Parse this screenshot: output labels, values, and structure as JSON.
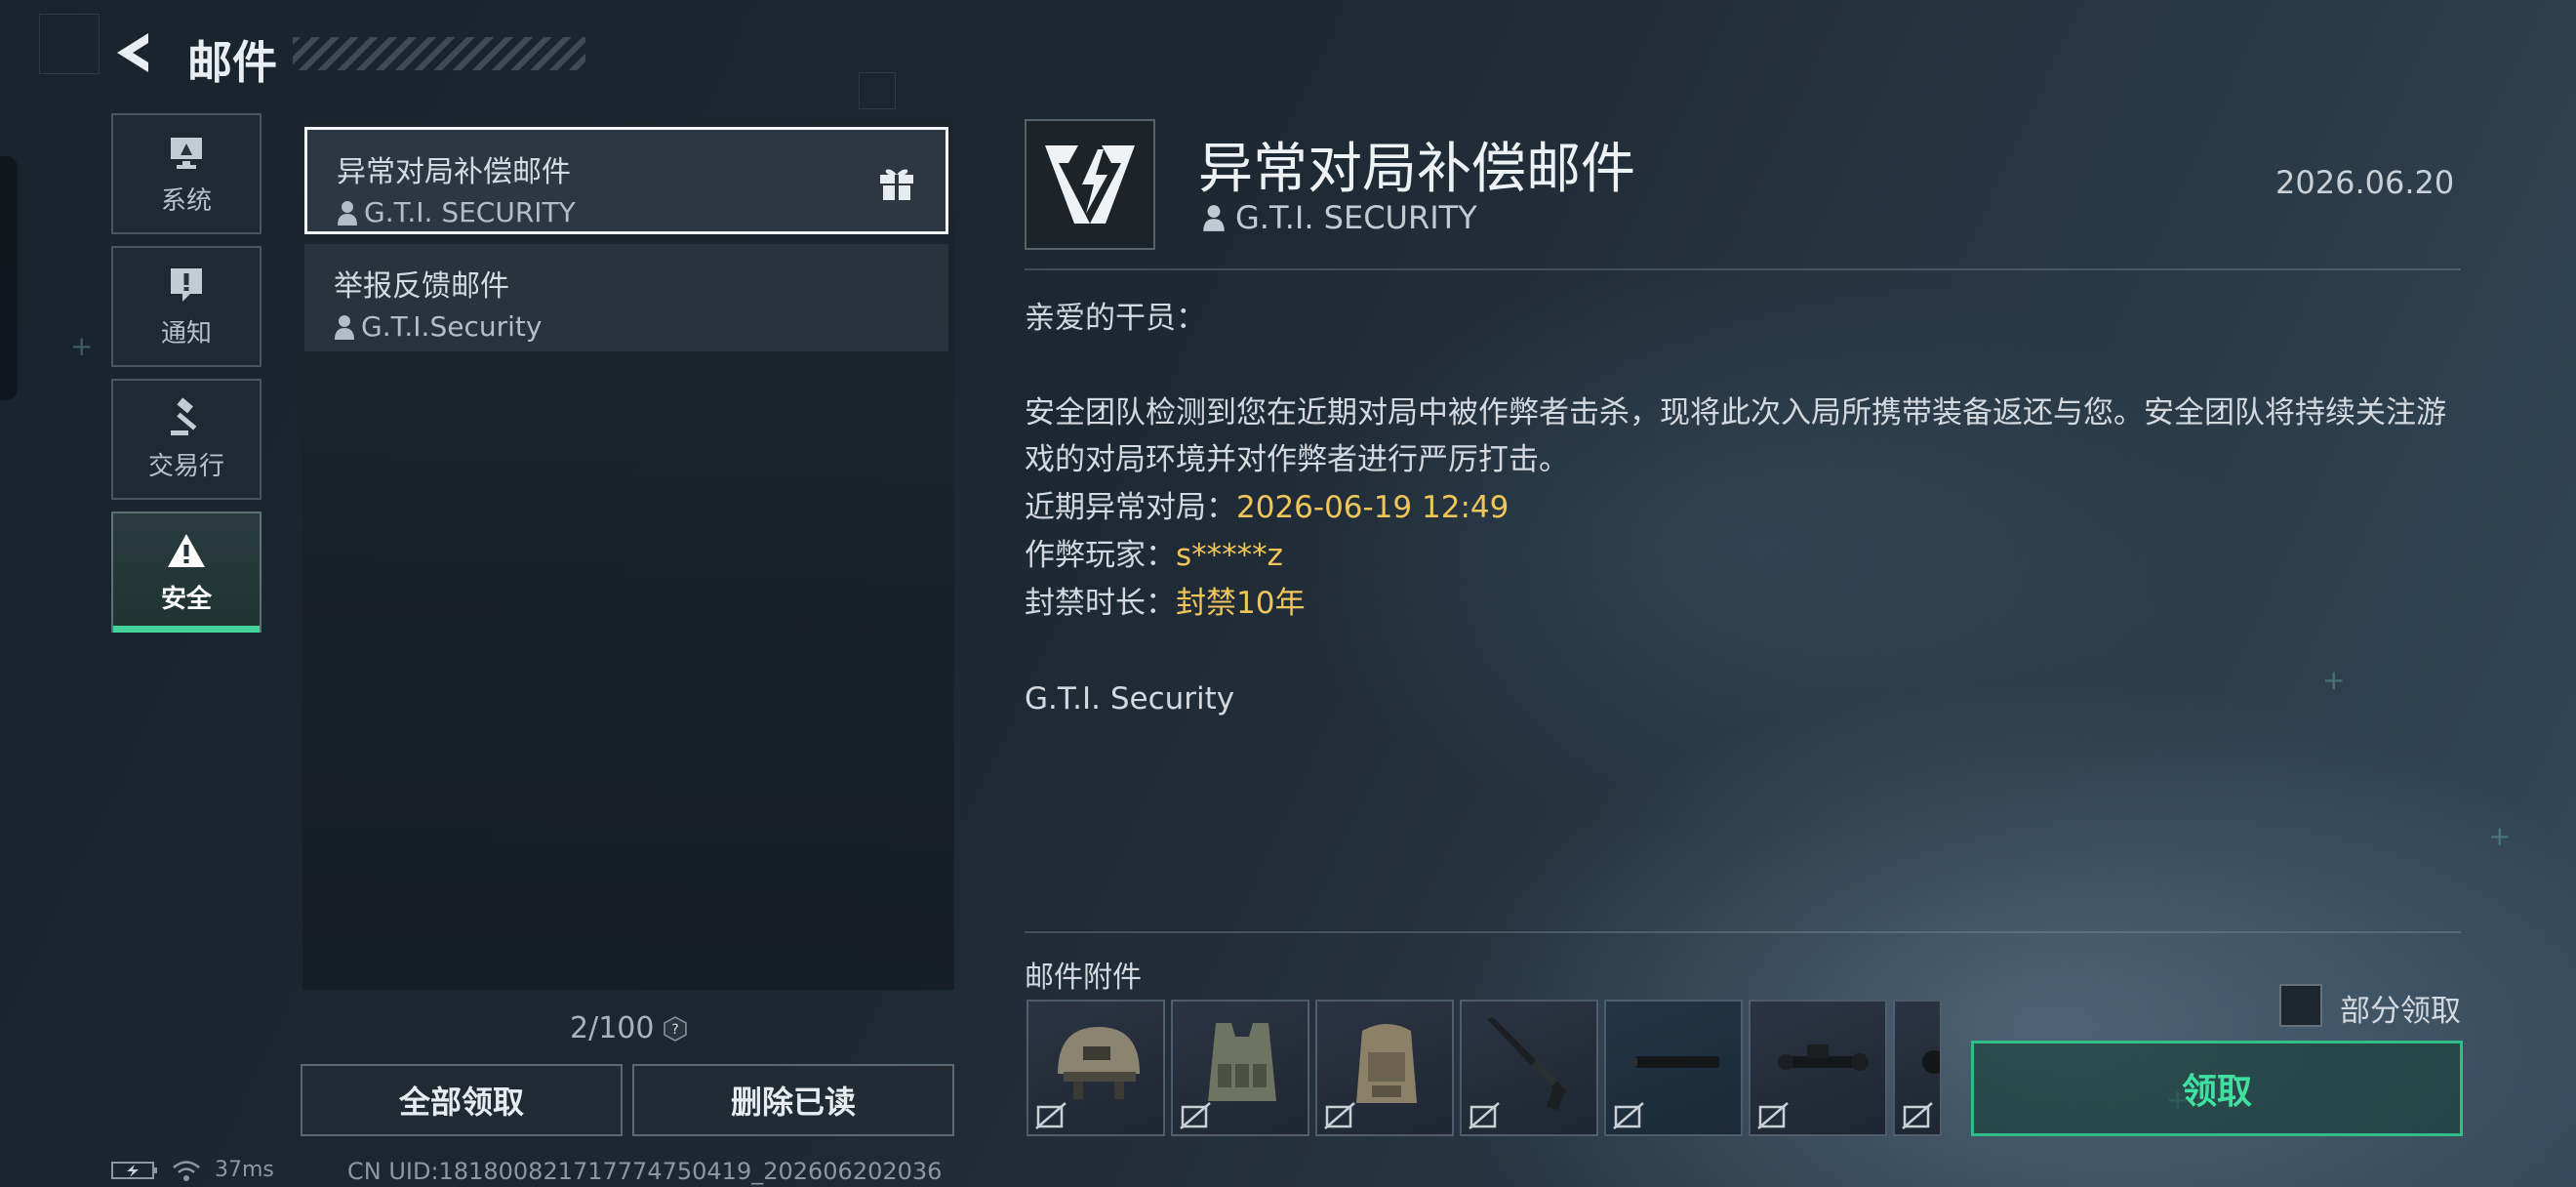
{
  "header": {
    "title": "邮件"
  },
  "tabs": [
    {
      "label": "系统",
      "icon": "monitor-icon",
      "active": false
    },
    {
      "label": "通知",
      "icon": "exclamation-icon",
      "active": false
    },
    {
      "label": "交易行",
      "icon": "gavel-icon",
      "active": false
    },
    {
      "label": "安全",
      "icon": "warning-icon",
      "active": true
    }
  ],
  "mails": [
    {
      "subject": "异常对局补偿邮件",
      "sender": "G.T.I. SECURITY",
      "has_gift": true,
      "selected": true
    },
    {
      "subject": "举报反馈邮件",
      "sender": "G.T.I.Security",
      "has_gift": false,
      "selected": false
    }
  ],
  "list_footer": {
    "counter": "2/100",
    "claim_all": "全部领取",
    "delete_read": "删除已读"
  },
  "status": {
    "ping": "37ms",
    "uid": "CN UID:181800821717774750419_202606202036"
  },
  "detail": {
    "title": "异常对局补偿邮件",
    "sender": "G.T.I. SECURITY",
    "date": "2026.06.20",
    "greeting": "亲爱的干员：",
    "paragraph": "安全团队检测到您在近期对局中被作弊者击杀，现将此次入局所携带装备返还与您。安全团队将持续关注游戏的对局环境并对作弊者进行严厉打击。",
    "match_label": "近期异常对局：",
    "match_value": "2026-06-19 12:49",
    "cheater_label": "作弊玩家：",
    "cheater_value": "s*****z",
    "ban_label": "封禁时长：",
    "ban_value": "封禁10年",
    "signature": "G.T.I. Security"
  },
  "attachments": {
    "label": "邮件附件",
    "items": [
      "helmet-icon",
      "vest-icon",
      "backpack-icon",
      "rifle-icon",
      "suppressor-icon",
      "scope-icon",
      "partial-item-icon"
    ],
    "partial_claim_label": "部分领取",
    "claim_label": "领取"
  },
  "colors": {
    "accent": "#43d39b",
    "highlight": "#f0c65a"
  }
}
